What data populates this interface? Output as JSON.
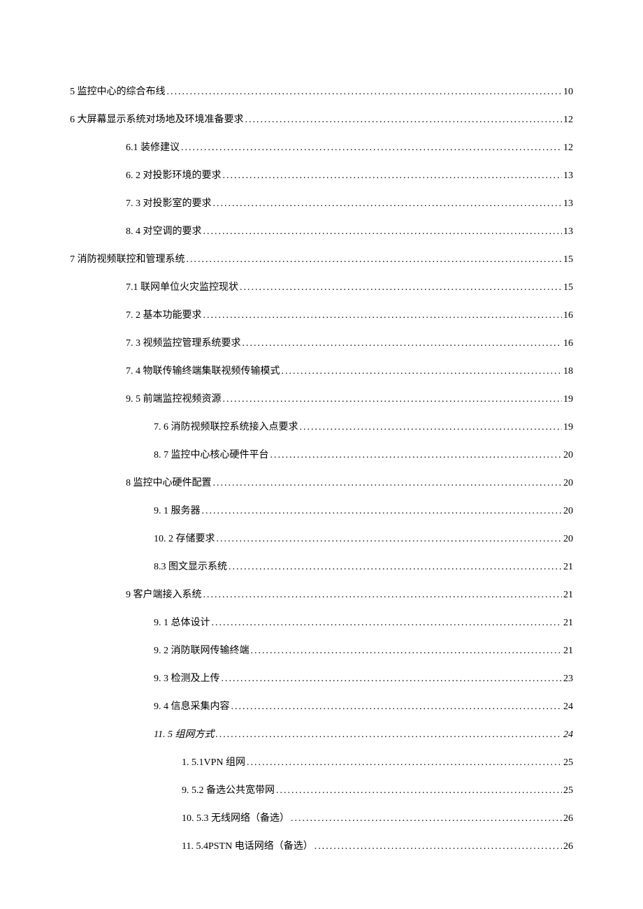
{
  "toc": [
    {
      "indent": 0,
      "label": "5 监控中心的综合布线",
      "page": "10",
      "italic": false
    },
    {
      "indent": 0,
      "label": "6 大屏幕显示系统对场地及环境准备要求",
      "page": "12",
      "italic": false
    },
    {
      "indent": 1,
      "label": "6.1 装修建议 ",
      "page": "12",
      "italic": false
    },
    {
      "indent": 1,
      "label": "6.  2 对投影环境的要求 ",
      "page": "13",
      "italic": false
    },
    {
      "indent": 1,
      "label": "7.  3 对投影室的要求 ",
      "page": "13",
      "italic": false
    },
    {
      "indent": 1,
      "label": "8.  4 对空调的要求 ",
      "page": "13",
      "italic": false
    },
    {
      "indent": 0,
      "label": "7 消防视频联控和管理系统",
      "page": "15",
      "italic": false
    },
    {
      "indent": 1,
      "label": "7.1 联网单位火灾监控现状 ",
      "page": "15",
      "italic": false
    },
    {
      "indent": 1,
      "label": "7.  2 基本功能要求 ",
      "page": "16",
      "italic": false
    },
    {
      "indent": 1,
      "label": "7.  3 视频监控管理系统要求 ",
      "page": "16",
      "italic": false
    },
    {
      "indent": 1,
      "label": "7.  4 物联传输终端集联视频传输模式 ",
      "page": "18",
      "italic": false
    },
    {
      "indent": 1,
      "label": "9.  5 前端监控视频资源 ",
      "page": "19",
      "italic": false
    },
    {
      "indent": 3,
      "label": "7.  6 消防视频联控系统接入点要求 ",
      "page": "19",
      "italic": false
    },
    {
      "indent": 3,
      "label": "8.  7 监控中心核心硬件平台 ",
      "page": "20",
      "italic": false
    },
    {
      "indent": 2,
      "label": "8 监控中心硬件配置",
      "page": "20",
      "italic": false
    },
    {
      "indent": 3,
      "label": "9.  1 服务器 ",
      "page": "20",
      "italic": false
    },
    {
      "indent": 3,
      "label": "10. 2 存储要求 ",
      "page": "20",
      "italic": false
    },
    {
      "indent": 3,
      "label": "8.3 图文显示系统 ",
      "page": "21",
      "italic": false
    },
    {
      "indent": 2,
      "label": "9 客户端接入系统",
      "page": "21",
      "italic": false
    },
    {
      "indent": 3,
      "label": "9.  1 总体设计 ",
      "page": "21",
      "italic": false
    },
    {
      "indent": 3,
      "label": "9.  2 消防联网传输终端 ",
      "page": "21",
      "italic": false
    },
    {
      "indent": 3,
      "label": "9.  3 检测及上传 ",
      "page": "23",
      "italic": false
    },
    {
      "indent": 3,
      "label": "9.  4 信息采集内容 ",
      "page": "24",
      "italic": false
    },
    {
      "indent": 3,
      "label": "11. 5 组网方式",
      "page": "24",
      "italic": true
    },
    {
      "indent": 4,
      "label": "1.  5.1VPN 组网",
      "page": "25",
      "italic": false
    },
    {
      "indent": 4,
      "label": "9.  5.2 备选公共宽带网",
      "page": "25",
      "italic": false
    },
    {
      "indent": 4,
      "label": "10. 5.3 无线网络（备选）",
      "page": "26",
      "italic": false
    },
    {
      "indent": 4,
      "label": "11. 5.4PSTN 电话网络（备选）",
      "page": "26",
      "italic": false
    }
  ]
}
